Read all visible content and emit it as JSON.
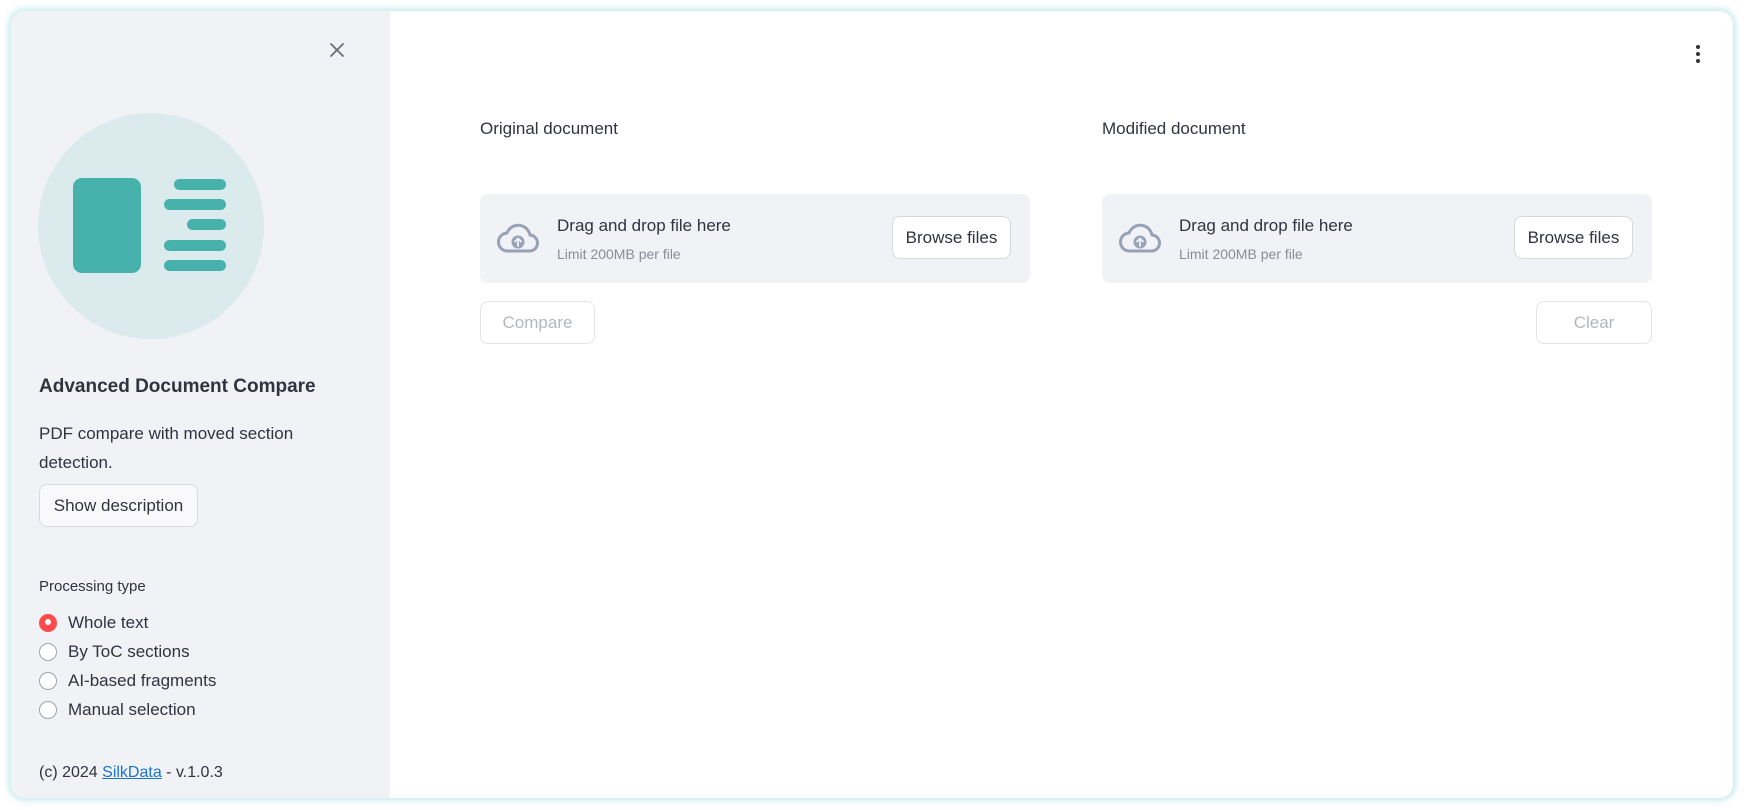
{
  "sidebar": {
    "close_icon": "close-icon",
    "logo_icon": "document-compare-logo",
    "app_title": "Advanced Document Compare",
    "app_description": "PDF compare with moved section detection.",
    "show_description_label": "Show description",
    "processing_type": {
      "label": "Processing type",
      "options": [
        {
          "label": "Whole text",
          "selected": true
        },
        {
          "label": "By ToC sections",
          "selected": false
        },
        {
          "label": "AI-based fragments",
          "selected": false
        },
        {
          "label": "Manual selection",
          "selected": false
        }
      ]
    },
    "footer": {
      "prefix": "(c) 2024 ",
      "link_text": "SilkData",
      "suffix": " - v.1.0.3"
    }
  },
  "main": {
    "menu_icon": "kebab-menu-icon",
    "original": {
      "label": "Original document",
      "dropzone_title": "Drag and drop file here",
      "dropzone_limit": "Limit 200MB per file",
      "browse_label": "Browse files"
    },
    "modified": {
      "label": "Modified document",
      "dropzone_title": "Drag and drop file here",
      "dropzone_limit": "Limit 200MB per file",
      "browse_label": "Browse files"
    },
    "compare_label": "Compare",
    "clear_label": "Clear"
  },
  "colors": {
    "accent": "#ff4b4b",
    "logo_teal": "#47b2ab",
    "sidebar_bg": "#f0f2f6",
    "link": "#1c73d1"
  }
}
